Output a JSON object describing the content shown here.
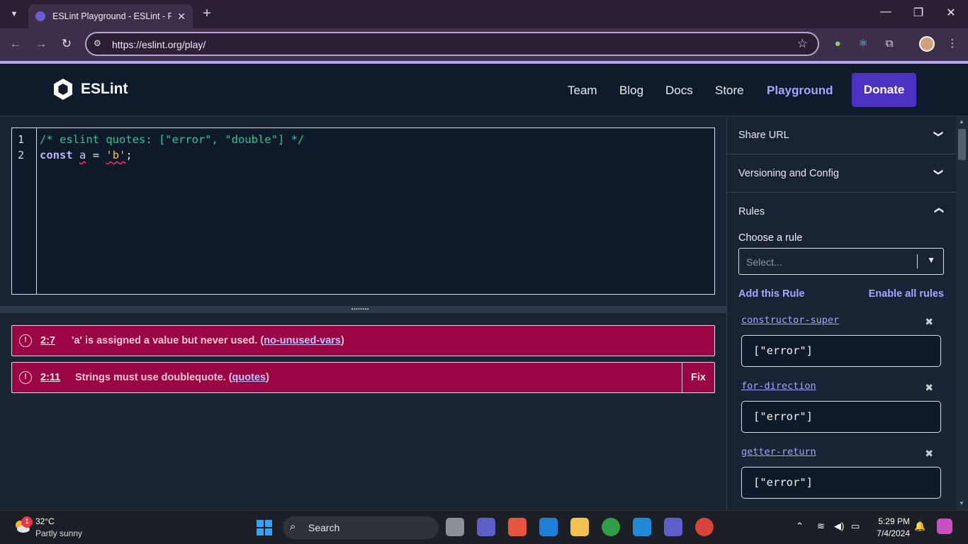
{
  "browser": {
    "tab_title": "ESLint Playground - ESLint - Plu",
    "url": "https://eslint.org/play/"
  },
  "site": {
    "brand": "ESLint",
    "nav": [
      "Team",
      "Blog",
      "Docs",
      "Store",
      "Playground"
    ],
    "donate_label": "Donate"
  },
  "editor": {
    "line_numbers": [
      "1",
      "2"
    ],
    "line1": "/* eslint quotes: [\"error\", \"double\"] */",
    "line2_kw": "const",
    "line2_var": "a",
    "line2_eq": " = ",
    "line2_str": "'b'",
    "line2_end": ";"
  },
  "messages": [
    {
      "loc": "2:7",
      "text": "'a' is assigned a value but never used.",
      "rule": "no-unused-vars"
    },
    {
      "loc": "2:11",
      "text": "Strings must use doublequote.",
      "rule": "quotes",
      "fix": "Fix"
    }
  ],
  "sidebar": {
    "sections": [
      "Share URL",
      "Versioning and Config",
      "Rules"
    ],
    "choose_label": "Choose a rule",
    "select_placeholder": "Select...",
    "add_rule": "Add this Rule",
    "enable_all": "Enable all rules",
    "rules": [
      {
        "name": "constructor-super",
        "value": "[\"error\"]"
      },
      {
        "name": "for-direction",
        "value": "[\"error\"]"
      },
      {
        "name": "getter-return",
        "value": "[\"error\"]"
      }
    ]
  },
  "taskbar": {
    "weather_badge": "1",
    "temperature": "32°C",
    "weather": "Partly sunny",
    "search_label": "Search",
    "time": "5:29 PM",
    "date": "7/4/2024"
  },
  "colors": {
    "accent": "#4b32c3",
    "link": "#a8a5ff",
    "error_bg": "#9a0643"
  }
}
